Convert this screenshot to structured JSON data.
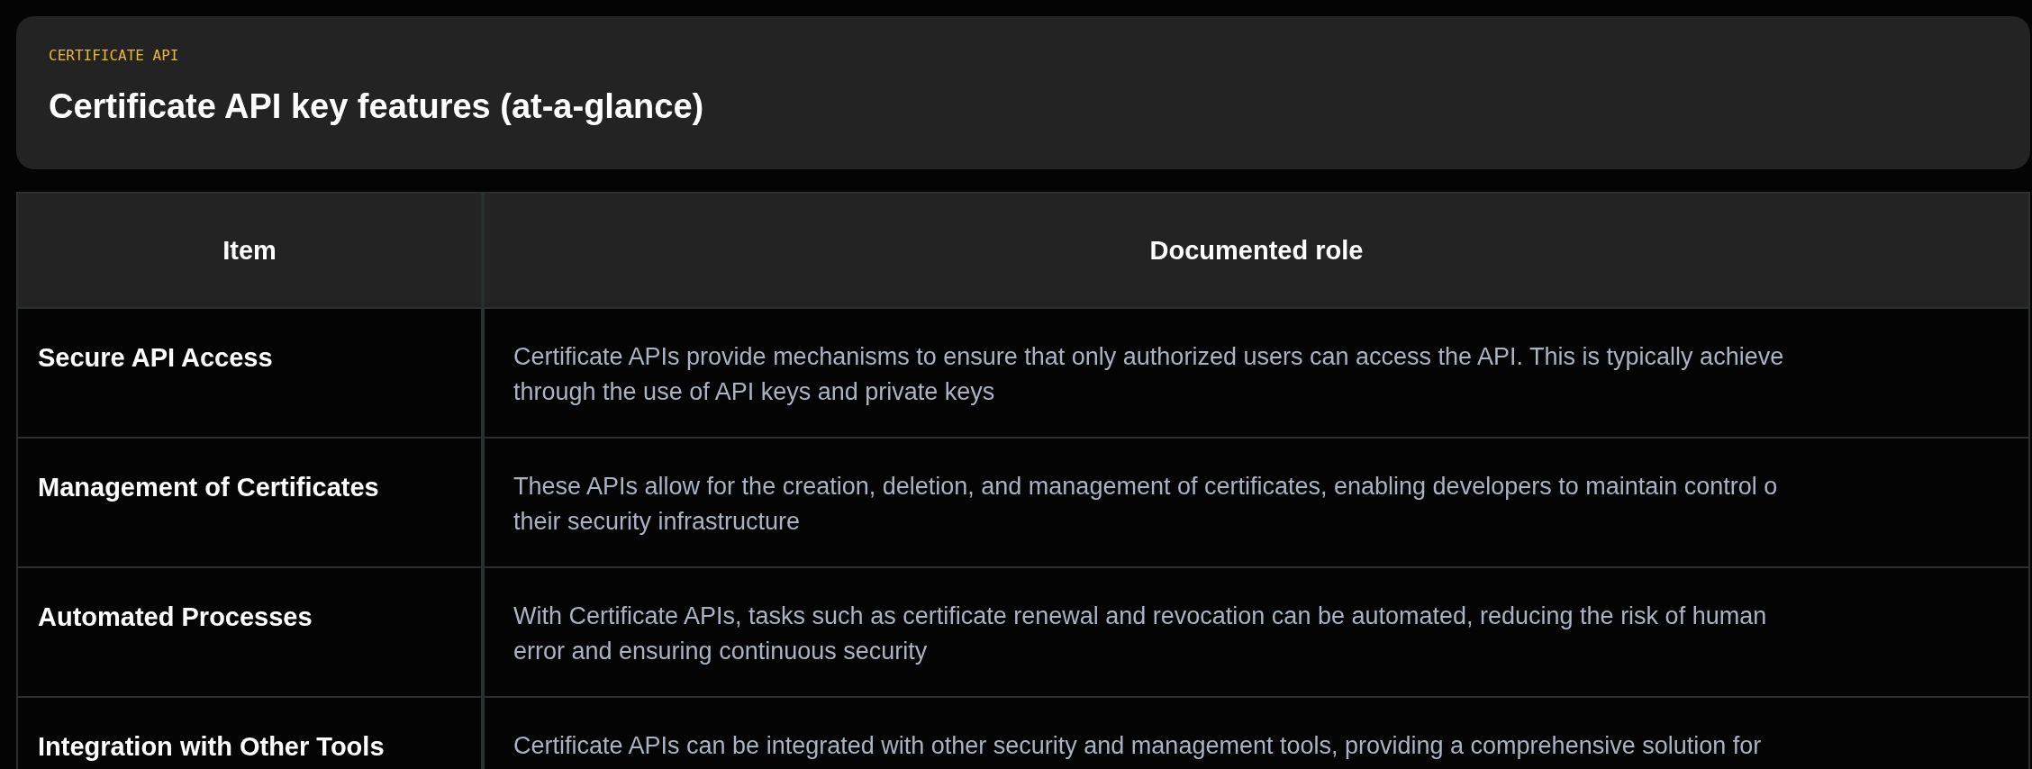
{
  "header": {
    "eyebrow": "CERTIFICATE API",
    "title": "Certificate API key features (at-a-glance)"
  },
  "table": {
    "columns": [
      "Item",
      "Documented role"
    ],
    "rows": [
      {
        "item": "Secure API Access",
        "role": "Certificate APIs provide mechanisms to ensure that only authorized users can access the API. This is typically achieve\nthrough the use of API keys and private keys"
      },
      {
        "item": "Management of Certificates",
        "role": "These APIs allow for the creation, deletion, and management of certificates, enabling developers to maintain control o\ntheir security infrastructure"
      },
      {
        "item": "Automated Processes",
        "role": "With Certificate APIs, tasks such as certificate renewal and revocation can be automated, reducing the risk of human\nerror and ensuring continuous security"
      },
      {
        "item": "Integration with Other Tools",
        "role": "Certificate APIs can be integrated with other security and management tools, providing a comprehensive solution for"
      }
    ]
  }
}
